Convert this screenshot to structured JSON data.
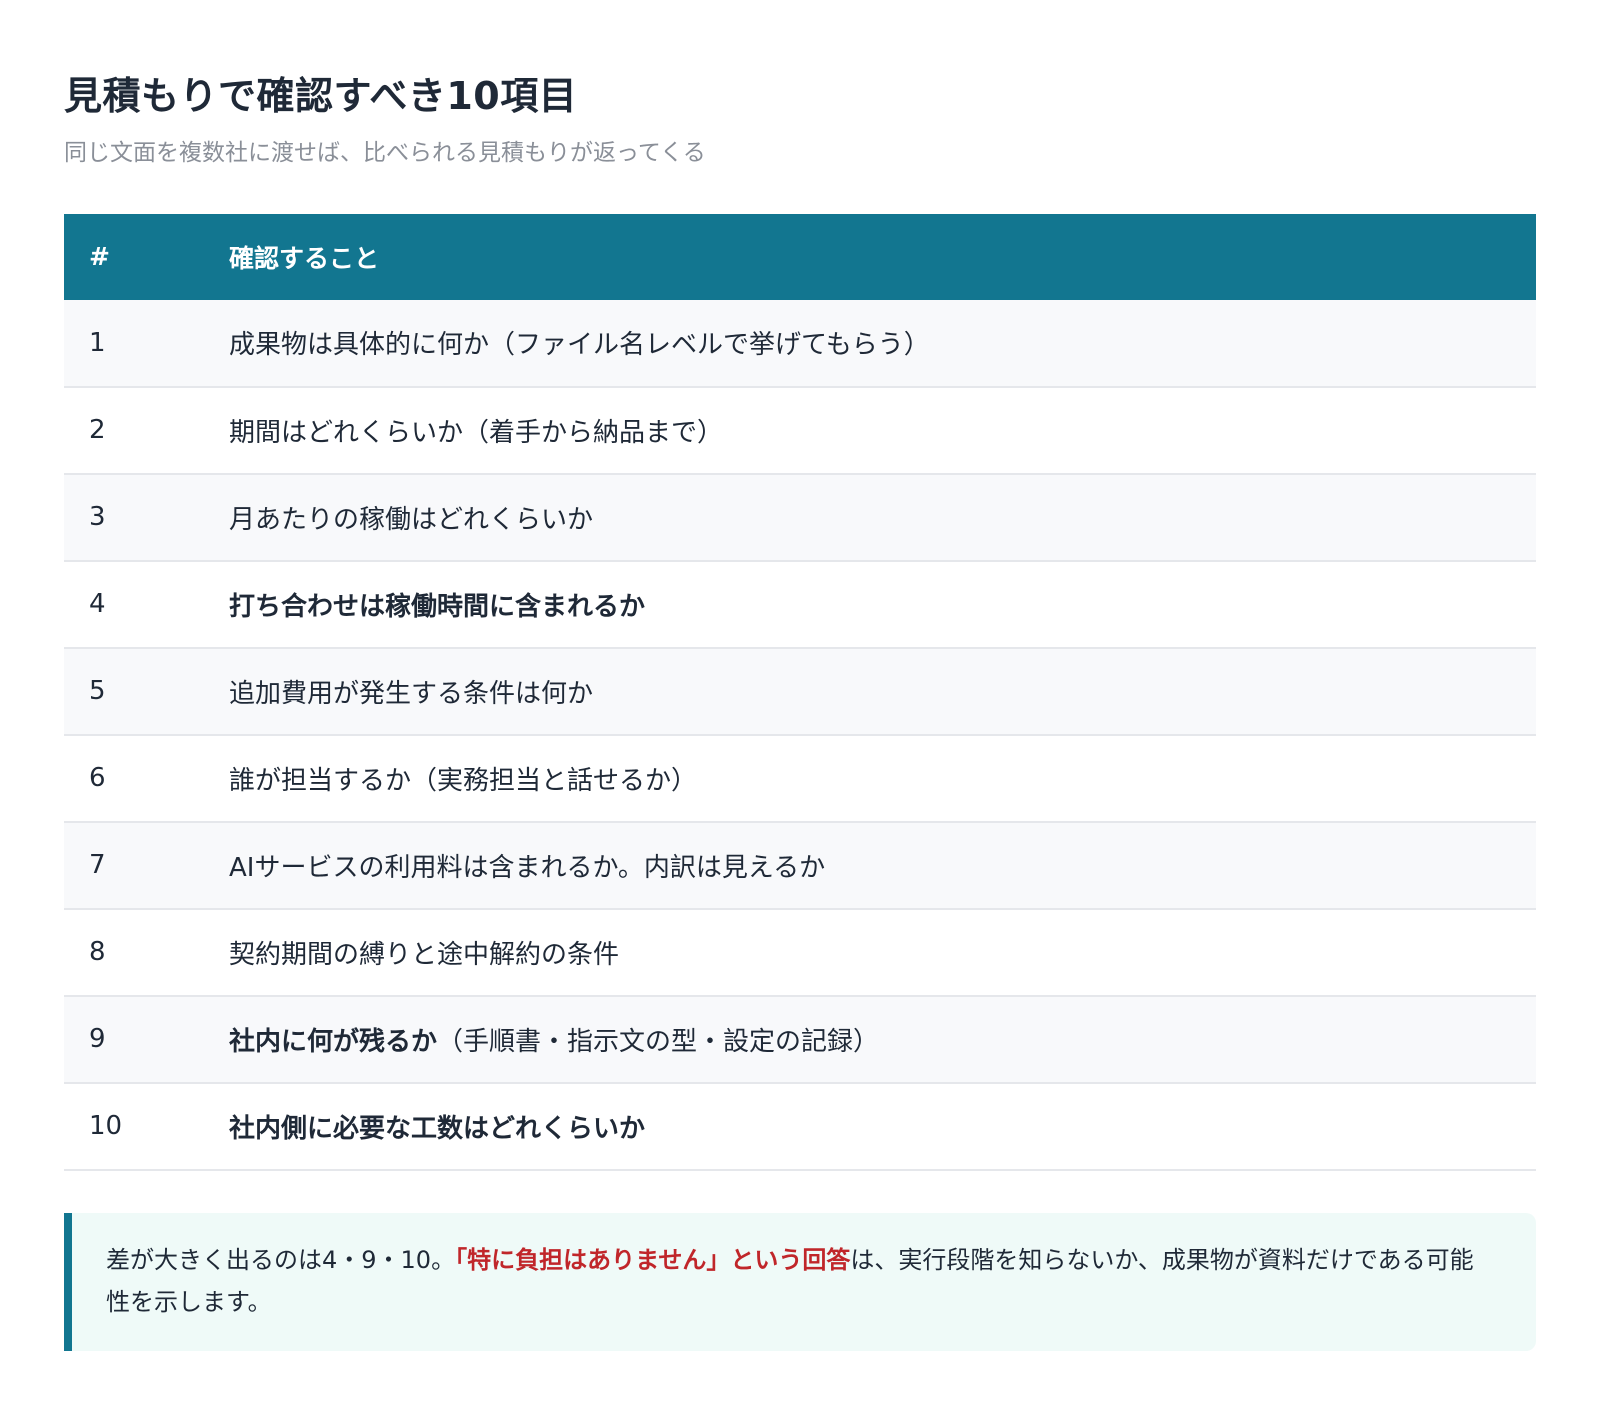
{
  "header": {
    "title": "見積もりで確認すべき10項目",
    "subtitle": "同じ文面を複数社に渡せば、比べられる見積もりが返ってくる"
  },
  "table": {
    "columns": [
      "#",
      "確認すること"
    ],
    "rows": [
      {
        "num": "1",
        "text": "成果物は具体的に何か（ファイル名レベルで挙げてもらう）",
        "bold": "",
        "rest": ""
      },
      {
        "num": "2",
        "text": "期間はどれくらいか（着手から納品まで）",
        "bold": "",
        "rest": ""
      },
      {
        "num": "3",
        "text": "月あたりの稼働はどれくらいか",
        "bold": "",
        "rest": ""
      },
      {
        "num": "4",
        "text": "",
        "bold": "打ち合わせは稼働時間に含まれるか",
        "rest": ""
      },
      {
        "num": "5",
        "text": "追加費用が発生する条件は何か",
        "bold": "",
        "rest": ""
      },
      {
        "num": "6",
        "text": "誰が担当するか（実務担当と話せるか）",
        "bold": "",
        "rest": ""
      },
      {
        "num": "7",
        "text": "AIサービスの利用料は含まれるか。内訳は見えるか",
        "bold": "",
        "rest": ""
      },
      {
        "num": "8",
        "text": "契約期間の縛りと途中解約の条件",
        "bold": "",
        "rest": ""
      },
      {
        "num": "9",
        "text": "",
        "bold": "社内に何が残るか",
        "rest": "（手順書・指示文の型・設定の記録）"
      },
      {
        "num": "10",
        "text": "",
        "bold": "社内側に必要な工数はどれくらいか",
        "rest": ""
      }
    ]
  },
  "note": {
    "before": "差が大きく出るのは4・9・10。",
    "highlight": "「特に負担はありません」という回答",
    "after": "は、実行段階を知らないか、成果物が資料だけである可能性を示します。"
  },
  "colors": {
    "header_bg": "#127690",
    "accent_red": "#c0262a",
    "note_bg": "#effaf8"
  }
}
